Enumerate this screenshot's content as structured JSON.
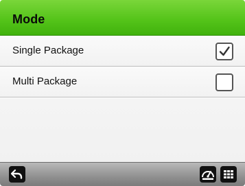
{
  "header": {
    "title": "Mode"
  },
  "options": [
    {
      "label": "Single Package",
      "checked": true
    },
    {
      "label": "Multi Package",
      "checked": false
    }
  ],
  "footer": {
    "left_icon": "back-arrow-icon",
    "right_icons": [
      "gauge-icon",
      "keypad-grid-icon"
    ]
  },
  "colors": {
    "header": "#55c41a",
    "footer": "#8f8f8f"
  }
}
